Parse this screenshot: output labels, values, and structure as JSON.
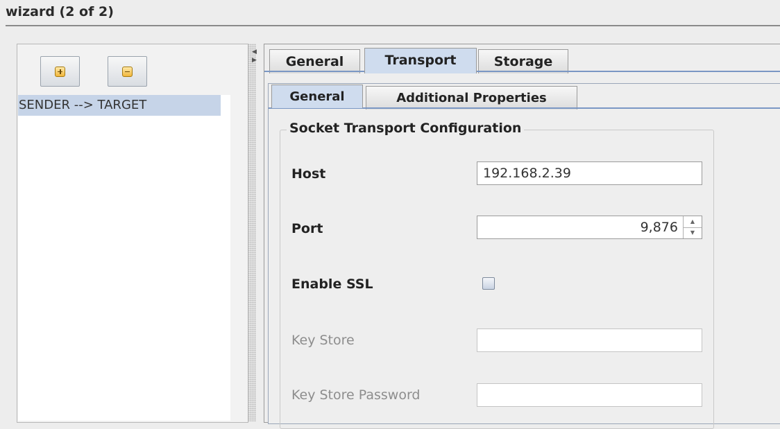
{
  "window": {
    "title": "wizard (2 of 2)"
  },
  "left_panel": {
    "add_icon": "plus-icon",
    "remove_icon": "minus-icon",
    "routes": [
      "SENDER --> TARGET"
    ]
  },
  "tabs": {
    "main": [
      "General",
      "Transport",
      "Storage"
    ],
    "main_selected": "Transport",
    "sub": [
      "General",
      "Additional Properties"
    ],
    "sub_selected": "General"
  },
  "form": {
    "section_title": "Socket Transport Configuration",
    "host_label": "Host",
    "host_value": "192.168.2.39",
    "port_label": "Port",
    "port_value": "9,876",
    "ssl_label": "Enable SSL",
    "ssl_checked": false,
    "keystore_label": "Key Store",
    "keystore_value": "",
    "keystore_password_label": "Key Store Password",
    "keystore_password_value": ""
  },
  "colors": {
    "selection": "#c6d4e8",
    "active_tab": "#cfdcee",
    "tab_line": "#7a97c4",
    "icon_fill": "#f2b63b"
  }
}
